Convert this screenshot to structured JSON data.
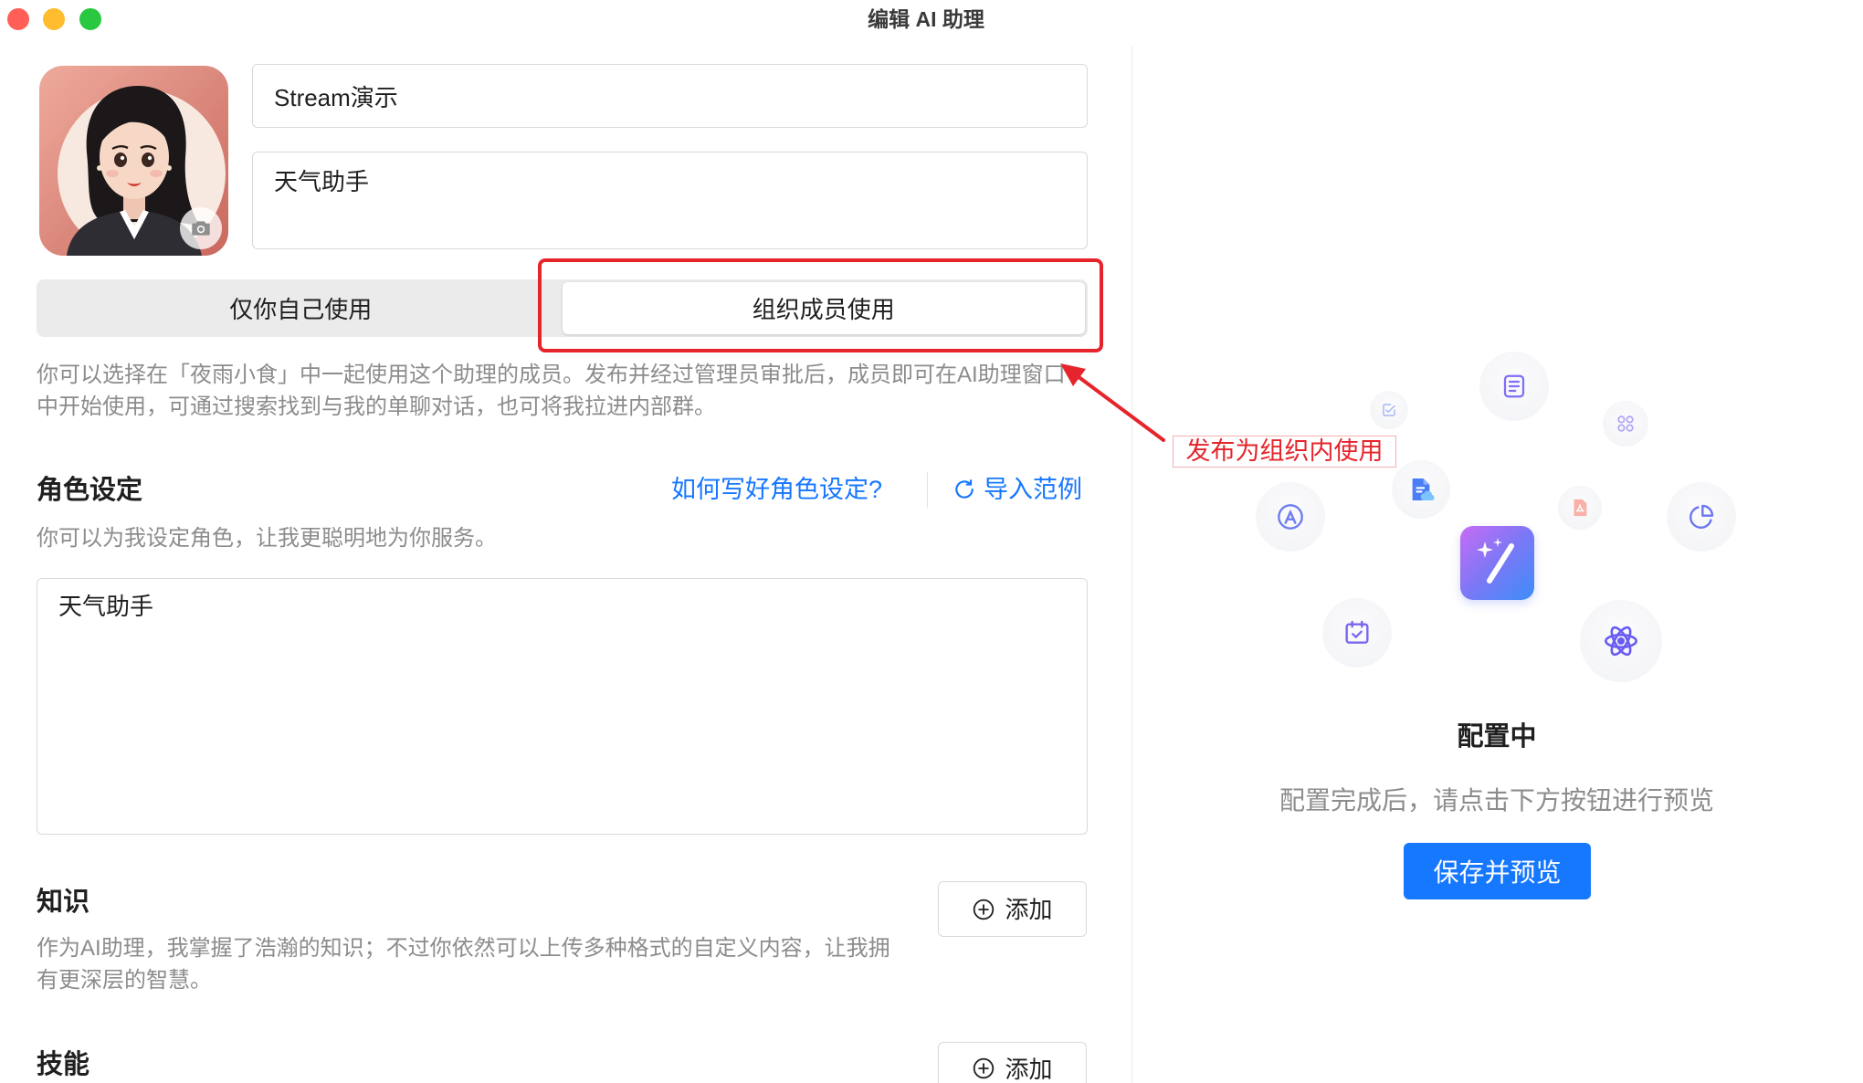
{
  "window": {
    "title": "编辑 AI 助理"
  },
  "profile": {
    "name": "Stream演示",
    "description": "天气助手",
    "avatar_icon": "camera-icon"
  },
  "visibility": {
    "options": [
      "仅你自己使用",
      "组织成员使用"
    ],
    "selected_index": 1,
    "hint": "你可以选择在「夜雨小食」中一起使用这个助理的成员。发布并经过管理员审批后，成员即可在AI助理窗口中开始使用，可通过搜索找到与我的单聊对话，也可将我拉进内部群。"
  },
  "role": {
    "heading": "角色设定",
    "help_link": "如何写好角色设定?",
    "import_label": "导入范例",
    "import_icon": "refresh-icon",
    "subtitle": "你可以为我设定角色，让我更聪明地为你服务。",
    "value": "天气助手"
  },
  "knowledge": {
    "heading": "知识",
    "add_label": "添加",
    "add_icon": "plus-circle-icon",
    "description": "作为AI助理，我掌握了浩瀚的知识；不过你依然可以上传多种格式的自定义内容，让我拥有更深层的智慧。"
  },
  "skills": {
    "heading": "技能",
    "add_label": "添加",
    "add_icon": "plus-circle-icon"
  },
  "preview": {
    "status_title": "配置中",
    "status_hint": "配置完成后，请点击下方按钮进行预览",
    "button_label": "保存并预览",
    "icons": [
      "document-icon",
      "checkbox-icon",
      "grid-icon",
      "cloud-document-icon",
      "app-store-icon",
      "pdf-icon",
      "pie-chart-icon",
      "calendar-check-icon",
      "atom-icon",
      "magic-wand-icon"
    ]
  },
  "annotation": {
    "label": "发布为组织内使用"
  },
  "colors": {
    "accent": "#1677ff",
    "annotation": "#e5242b",
    "muted_text": "#8c8c8c",
    "traffic_close": "#ff5f57",
    "traffic_minimize": "#febc2e",
    "traffic_zoom": "#28c840"
  }
}
